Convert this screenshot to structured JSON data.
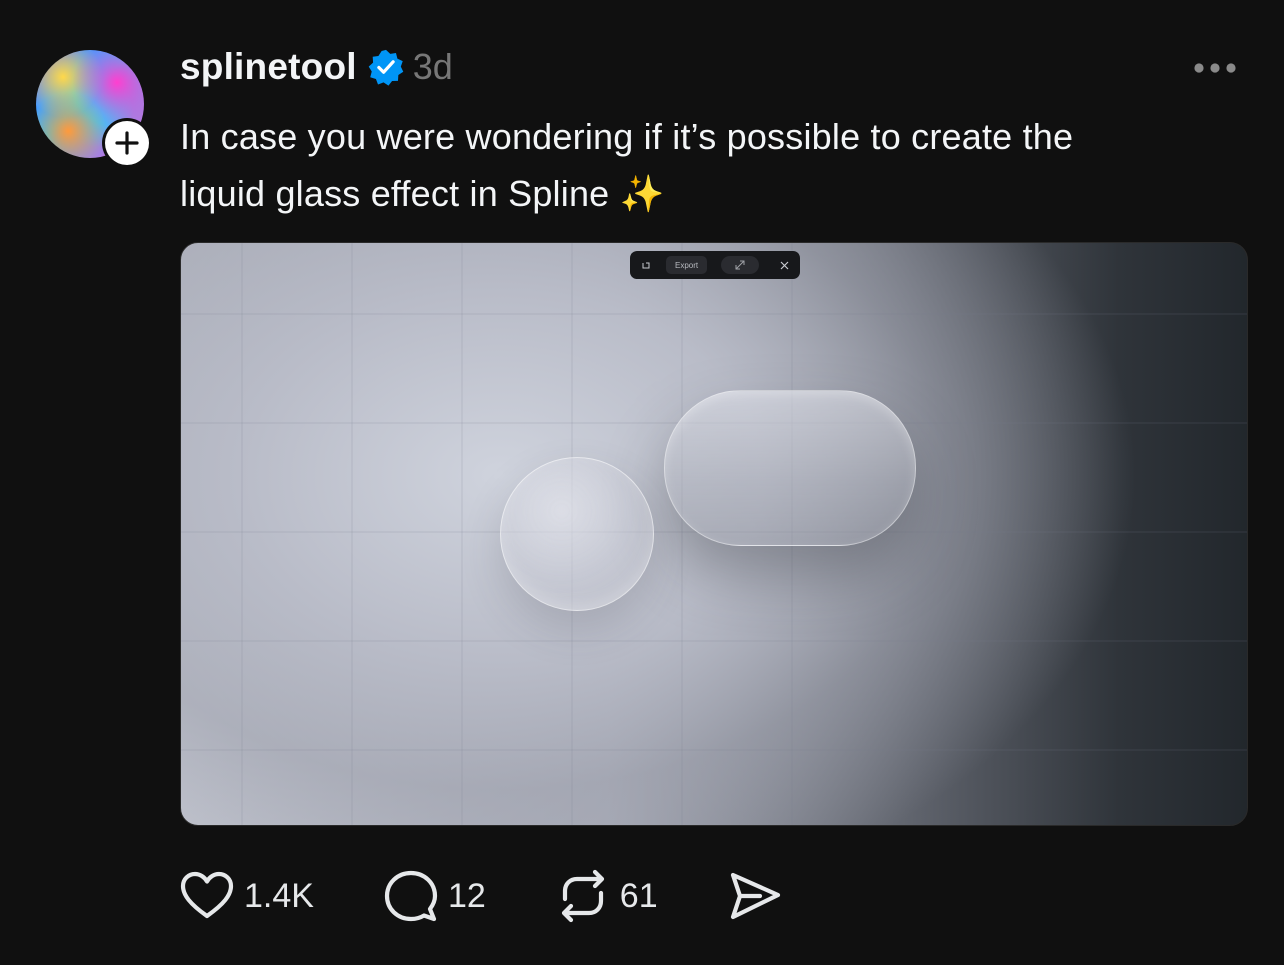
{
  "post": {
    "username": "splinetool",
    "verified": true,
    "timestamp": "3d",
    "caption_line1": "In case you were wondering if it’s possible to create the",
    "caption_line2": "liquid glass effect in Spline ✨",
    "more_icon": "more-horizontal-icon",
    "avatar_badge_icon": "plus-icon"
  },
  "media": {
    "toolbar": {
      "export_label": "Export",
      "icons": [
        "rotate-icon",
        "expand-icon",
        "close-icon"
      ]
    }
  },
  "actions": {
    "likes": "1.4K",
    "replies": "12",
    "reposts": "61",
    "icons": [
      "heart-icon",
      "comment-icon",
      "repost-icon",
      "share-icon"
    ]
  },
  "colors": {
    "background": "#101010",
    "text": "#f3f5f7",
    "muted": "#777777",
    "verified_blue": "#0095f6"
  }
}
